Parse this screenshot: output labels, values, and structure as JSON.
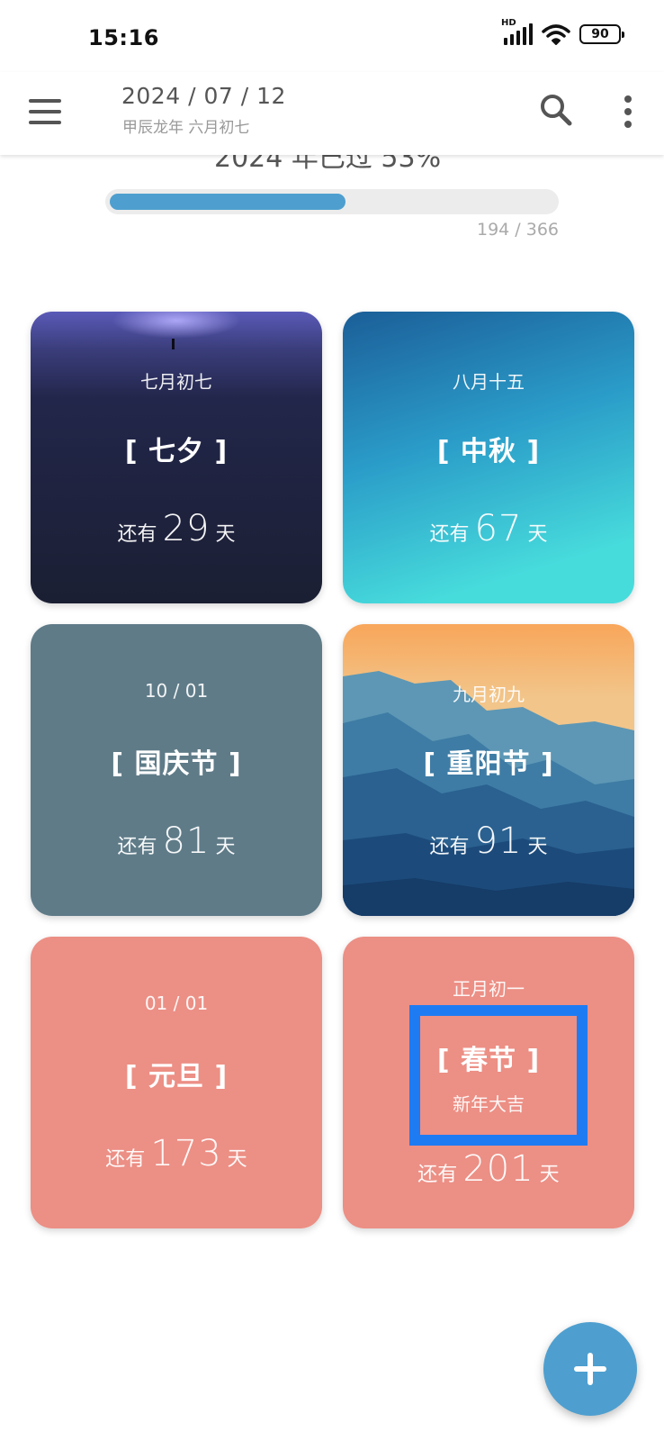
{
  "status_bar": {
    "time": "15:16",
    "network_label": "HD",
    "battery": "90"
  },
  "app_bar": {
    "date": "2024 / 07 / 12",
    "lunar": "甲辰龙年 六月初七",
    "menu_icon": "hamburger-menu-icon",
    "search_icon": "search-icon",
    "more_icon": "more-vertical-icon"
  },
  "year_progress": {
    "label": "2024 年已过 53%",
    "count": "194 / 366",
    "fraction": 0.53
  },
  "countdown_prefix": "还有",
  "countdown_suffix": "天",
  "cards": [
    {
      "date": "七月初七",
      "name": "[ 七夕 ]",
      "days": "29"
    },
    {
      "date": "八月十五",
      "name": "[ 中秋 ]",
      "days": "67"
    },
    {
      "date": "10 / 01",
      "name": "[ 国庆节 ]",
      "days": "81"
    },
    {
      "date": "九月初九",
      "name": "[ 重阳节 ]",
      "days": "91"
    },
    {
      "date": "01 / 01",
      "name": "[ 元旦 ]",
      "days": "173"
    },
    {
      "date": "正月初一",
      "name": "[ 春节 ]",
      "greeting": "新年大吉",
      "days": "201"
    }
  ],
  "colors": {
    "accent": "#4e9fcf",
    "highlight": "#1f7bf2",
    "card_qixi": "#1c2035",
    "card_zhongqiu": "#2a8fc2",
    "card_guoqing": "#5f7b88",
    "card_chongyang": "#2f6a94",
    "card_red": "#ec8f85"
  },
  "fab": {
    "icon": "plus-icon"
  }
}
